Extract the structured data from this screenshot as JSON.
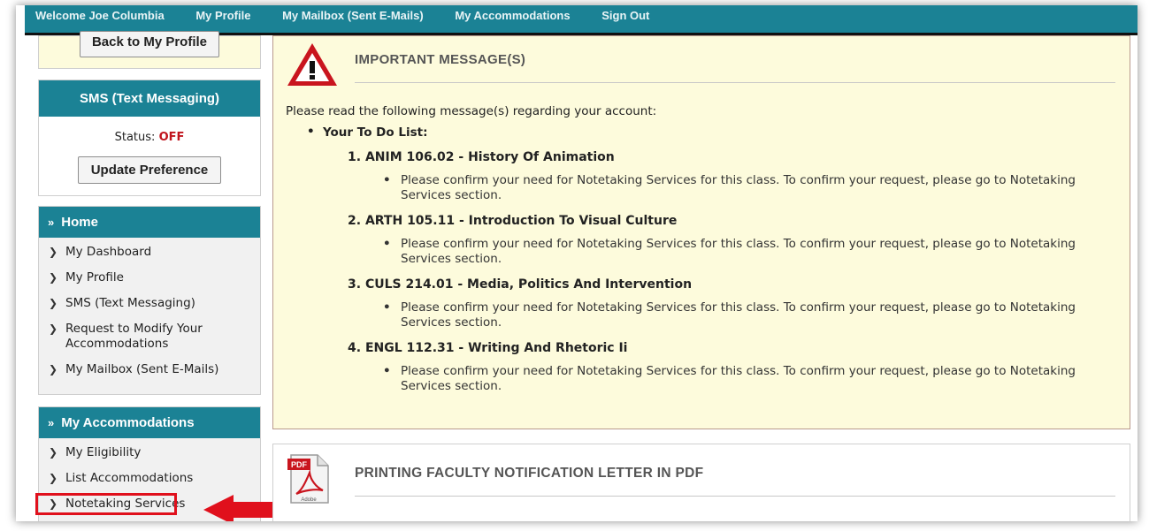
{
  "topnav": {
    "welcome": "Welcome Joe Columbia",
    "items": [
      "My Profile",
      "My Mailbox (Sent E-Mails)",
      "My Accommodations",
      "Sign Out"
    ]
  },
  "sidebar": {
    "back_button": "Back to My Profile",
    "sms": {
      "title": "SMS (Text Messaging)",
      "status_label": "Status:",
      "status_value": "OFF",
      "update_button": "Update Preference"
    },
    "home": {
      "title": "Home",
      "items": [
        "My Dashboard",
        "My Profile",
        "SMS (Text Messaging)",
        "Request to Modify Your Accommodations",
        "My Mailbox (Sent E-Mails)"
      ]
    },
    "accommodations": {
      "title": "My Accommodations",
      "items": [
        "My Eligibility",
        "List Accommodations",
        "Notetaking Services"
      ]
    }
  },
  "important": {
    "title": "IMPORTANT MESSAGE(S)",
    "intro": "Please read the following message(s) regarding your account:",
    "todo_title": "Your To Do List:",
    "courses": [
      {
        "num": "1.",
        "title": "ANIM 106.02 - History Of Animation",
        "note": "Please confirm your need for Notetaking Services for this class. To confirm your request, please go to Notetaking Services section."
      },
      {
        "num": "2.",
        "title": "ARTH 105.11 - Introduction To Visual Culture",
        "note": "Please confirm your need for Notetaking Services for this class. To confirm your request, please go to Notetaking Services section."
      },
      {
        "num": "3.",
        "title": "CULS 214.01 - Media, Politics And Intervention",
        "note": "Please confirm your need for Notetaking Services for this class. To confirm your request, please go to Notetaking Services section."
      },
      {
        "num": "4.",
        "title": "ENGL 112.31 - Writing And Rhetoric Ii",
        "note": "Please confirm your need for Notetaking Services for this class. To confirm your request, please go to Notetaking Services section."
      }
    ]
  },
  "pdf": {
    "title": "PRINTING FACULTY NOTIFICATION LETTER IN PDF",
    "icon_label": "PDF",
    "icon_brand": "Adobe"
  },
  "colors": {
    "teal": "#1b8295",
    "message_bg": "#fdfbdc",
    "status_off": "#c0141d",
    "highlight": "#e0101c"
  }
}
